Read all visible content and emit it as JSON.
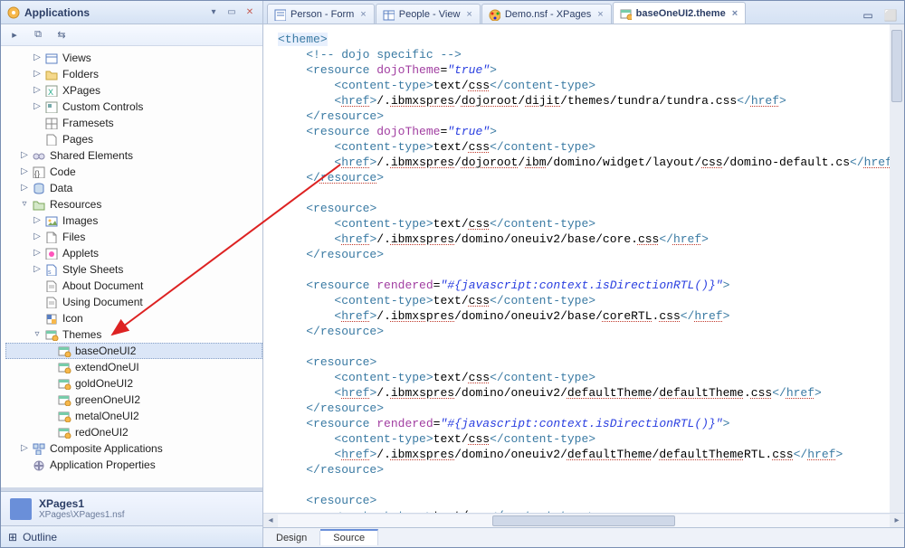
{
  "sidebar": {
    "title": "Applications",
    "tree": [
      {
        "caret": "▷",
        "icon": "views",
        "label": "Views",
        "ind": 1
      },
      {
        "caret": "▷",
        "icon": "folders",
        "label": "Folders",
        "ind": 1
      },
      {
        "caret": "▷",
        "icon": "xpages",
        "label": "XPages",
        "ind": 1
      },
      {
        "caret": "▷",
        "icon": "custom",
        "label": "Custom Controls",
        "ind": 1
      },
      {
        "caret": "",
        "icon": "frame",
        "label": "Framesets",
        "ind": 1
      },
      {
        "caret": "",
        "icon": "page",
        "label": "Pages",
        "ind": 1
      },
      {
        "caret": "▷",
        "icon": "shared",
        "label": "Shared Elements",
        "ind": 0
      },
      {
        "caret": "▷",
        "icon": "code",
        "label": "Code",
        "ind": 0
      },
      {
        "caret": "▷",
        "icon": "data",
        "label": "Data",
        "ind": 0
      },
      {
        "caret": "▿",
        "icon": "res",
        "label": "Resources",
        "ind": 0
      },
      {
        "caret": "▷",
        "icon": "img",
        "label": "Images",
        "ind": 1
      },
      {
        "caret": "▷",
        "icon": "file",
        "label": "Files",
        "ind": 1
      },
      {
        "caret": "▷",
        "icon": "applet",
        "label": "Applets",
        "ind": 1
      },
      {
        "caret": "▷",
        "icon": "css",
        "label": "Style Sheets",
        "ind": 1
      },
      {
        "caret": "",
        "icon": "doc",
        "label": "About Document",
        "ind": 1
      },
      {
        "caret": "",
        "icon": "doc",
        "label": "Using Document",
        "ind": 1
      },
      {
        "caret": "",
        "icon": "icon",
        "label": "Icon",
        "ind": 1
      },
      {
        "caret": "▿",
        "icon": "theme",
        "label": "Themes",
        "ind": 1
      },
      {
        "caret": "",
        "icon": "theme",
        "label": "baseOneUI2",
        "ind": 2,
        "sel": true
      },
      {
        "caret": "",
        "icon": "theme",
        "label": "extendOneUI",
        "ind": 2
      },
      {
        "caret": "",
        "icon": "theme",
        "label": "goldOneUI2",
        "ind": 2
      },
      {
        "caret": "",
        "icon": "theme",
        "label": "greenOneUI2",
        "ind": 2
      },
      {
        "caret": "",
        "icon": "theme",
        "label": "metalOneUI2",
        "ind": 2
      },
      {
        "caret": "",
        "icon": "theme",
        "label": "redOneUI2",
        "ind": 2
      },
      {
        "caret": "▷",
        "icon": "comp",
        "label": "Composite Applications",
        "ind": 0
      },
      {
        "caret": "",
        "icon": "props",
        "label": "Application Properties",
        "ind": 0
      }
    ],
    "bottom": {
      "title": "XPages1",
      "sub": "XPages\\XPages1.nsf"
    },
    "outline": "Outline"
  },
  "tabs": [
    {
      "icon": "form",
      "label": "Person - Form"
    },
    {
      "icon": "view",
      "label": "People - View"
    },
    {
      "icon": "nsf",
      "label": "Demo.nsf - XPages"
    },
    {
      "icon": "theme",
      "label": "baseOneUI2.theme",
      "active": true
    }
  ],
  "srctabs": {
    "design": "Design",
    "source": "Source"
  },
  "code": [
    {
      "t": "open",
      "tag": "theme",
      "hl": true
    },
    {
      "t": "comment",
      "text": "<!-- dojo specific -->"
    },
    {
      "t": "open",
      "tag": "resource",
      "attrs": [
        {
          "n": "dojoTheme",
          "v": "true"
        }
      ],
      "i": 1
    },
    {
      "t": "ct",
      "val": "text/css",
      "i": 2,
      "ul": true
    },
    {
      "t": "href",
      "val": "/.ibmxspres/dojoroot/dijit/themes/tundra/tundra.css",
      "i": 2,
      "ul": [
        "ibmxspres",
        "dojoroot",
        "dijit"
      ]
    },
    {
      "t": "close",
      "tag": "resource",
      "i": 1
    },
    {
      "t": "open",
      "tag": "resource",
      "attrs": [
        {
          "n": "dojoTheme",
          "v": "true"
        }
      ],
      "i": 1
    },
    {
      "t": "ct",
      "val": "text/css",
      "i": 2,
      "ul": true
    },
    {
      "t": "href",
      "val": "/.ibmxspres/dojoroot/ibm/domino/widget/layout/css/domino-default.cs",
      "i": 2,
      "ul": [
        "ibmxspres",
        "dojoroot",
        "ibm",
        "css"
      ]
    },
    {
      "t": "close",
      "tag": "resource",
      "i": 1,
      "ul": true
    },
    {
      "t": "blank"
    },
    {
      "t": "open",
      "tag": "resource",
      "i": 1
    },
    {
      "t": "ct",
      "val": "text/css",
      "i": 2,
      "ul": true
    },
    {
      "t": "href",
      "val": "/.ibmxspres/domino/oneuiv2/base/core.css",
      "i": 2,
      "ul": [
        "ibmxspres",
        "css"
      ]
    },
    {
      "t": "close",
      "tag": "resource",
      "i": 1
    },
    {
      "t": "blank"
    },
    {
      "t": "open",
      "tag": "resource",
      "attrs": [
        {
          "n": "rendered",
          "v": "#{javascript:context.isDirectionRTL()}"
        }
      ],
      "i": 1,
      "st": true
    },
    {
      "t": "ct",
      "val": "text/css",
      "i": 2,
      "ul": true
    },
    {
      "t": "href",
      "val": "/.ibmxspres/domino/oneuiv2/base/coreRTL.css",
      "i": 2,
      "ul": [
        "ibmxspres",
        "coreRTL",
        "css"
      ]
    },
    {
      "t": "close",
      "tag": "resource",
      "i": 1
    },
    {
      "t": "blank"
    },
    {
      "t": "open",
      "tag": "resource",
      "i": 1
    },
    {
      "t": "ct",
      "val": "text/css",
      "i": 2,
      "ul": true
    },
    {
      "t": "href",
      "val": "/.ibmxspres/domino/oneuiv2/defaultTheme/defaultTheme.css",
      "i": 2,
      "ul": [
        "ibmxspres",
        "defaultTheme",
        "defaultTheme",
        "css"
      ]
    },
    {
      "t": "close",
      "tag": "resource",
      "i": 1
    },
    {
      "t": "open",
      "tag": "resource",
      "attrs": [
        {
          "n": "rendered",
          "v": "#{javascript:context.isDirectionRTL()}"
        }
      ],
      "i": 1,
      "st": true
    },
    {
      "t": "ct",
      "val": "text/css",
      "i": 2,
      "ul": true
    },
    {
      "t": "href",
      "val": "/.ibmxspres/domino/oneuiv2/defaultTheme/defaultThemeRTL.css",
      "i": 2,
      "ul": [
        "ibmxspres",
        "defaultTheme",
        "defaultThemeRTL",
        "css"
      ]
    },
    {
      "t": "close",
      "tag": "resource",
      "i": 1
    },
    {
      "t": "blank"
    },
    {
      "t": "open",
      "tag": "resource",
      "i": 1
    },
    {
      "t": "ct-partial",
      "val": "text/css",
      "i": 2
    }
  ]
}
